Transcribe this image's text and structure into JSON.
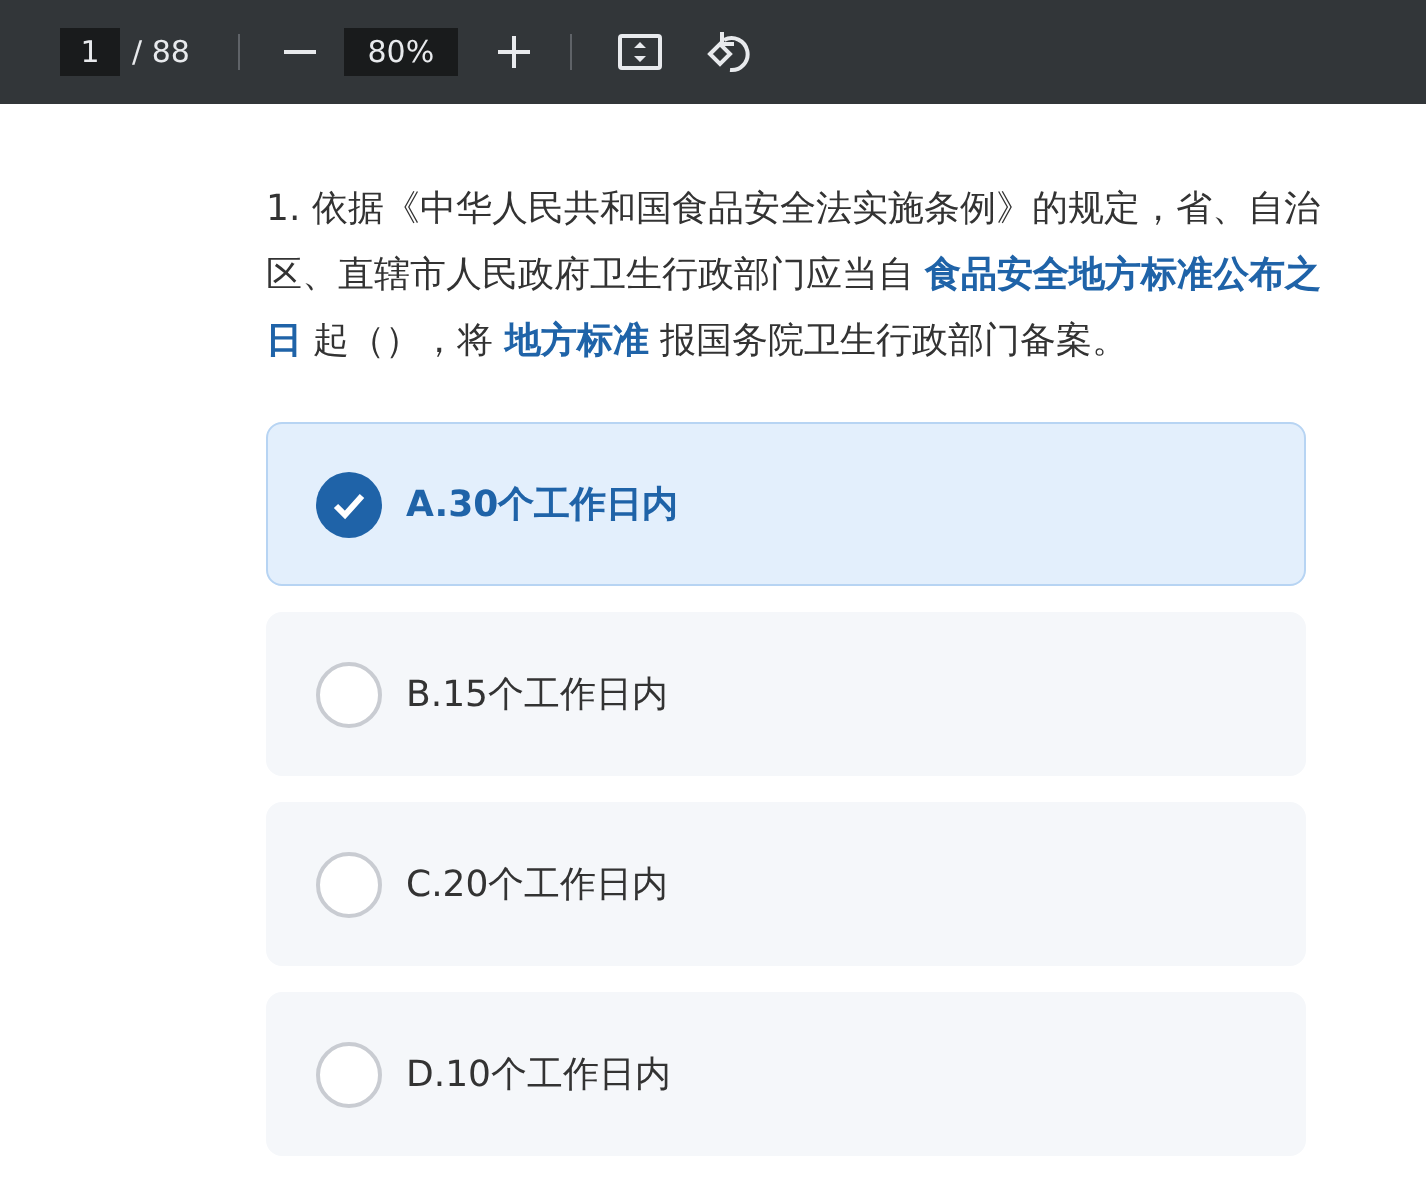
{
  "toolbar": {
    "page": "1",
    "page_total": "/ 88",
    "zoom": "80%"
  },
  "question": "1. 依据《中华人民共和国食品安全法实施条例》的规定，省、自治区、直辖市人民政府卫生行政部门应当自 **食品安全地方标准公布之日** 起（），将 **地方标准** 报国务院卫生行政部门备案。",
  "options": [
    {
      "label": "A.30个工作日内",
      "selected": true
    },
    {
      "label": "B.15个工作日内",
      "selected": false
    },
    {
      "label": "C.20个工作日内",
      "selected": false
    },
    {
      "label": "D.10个工作日内",
      "selected": false
    }
  ]
}
